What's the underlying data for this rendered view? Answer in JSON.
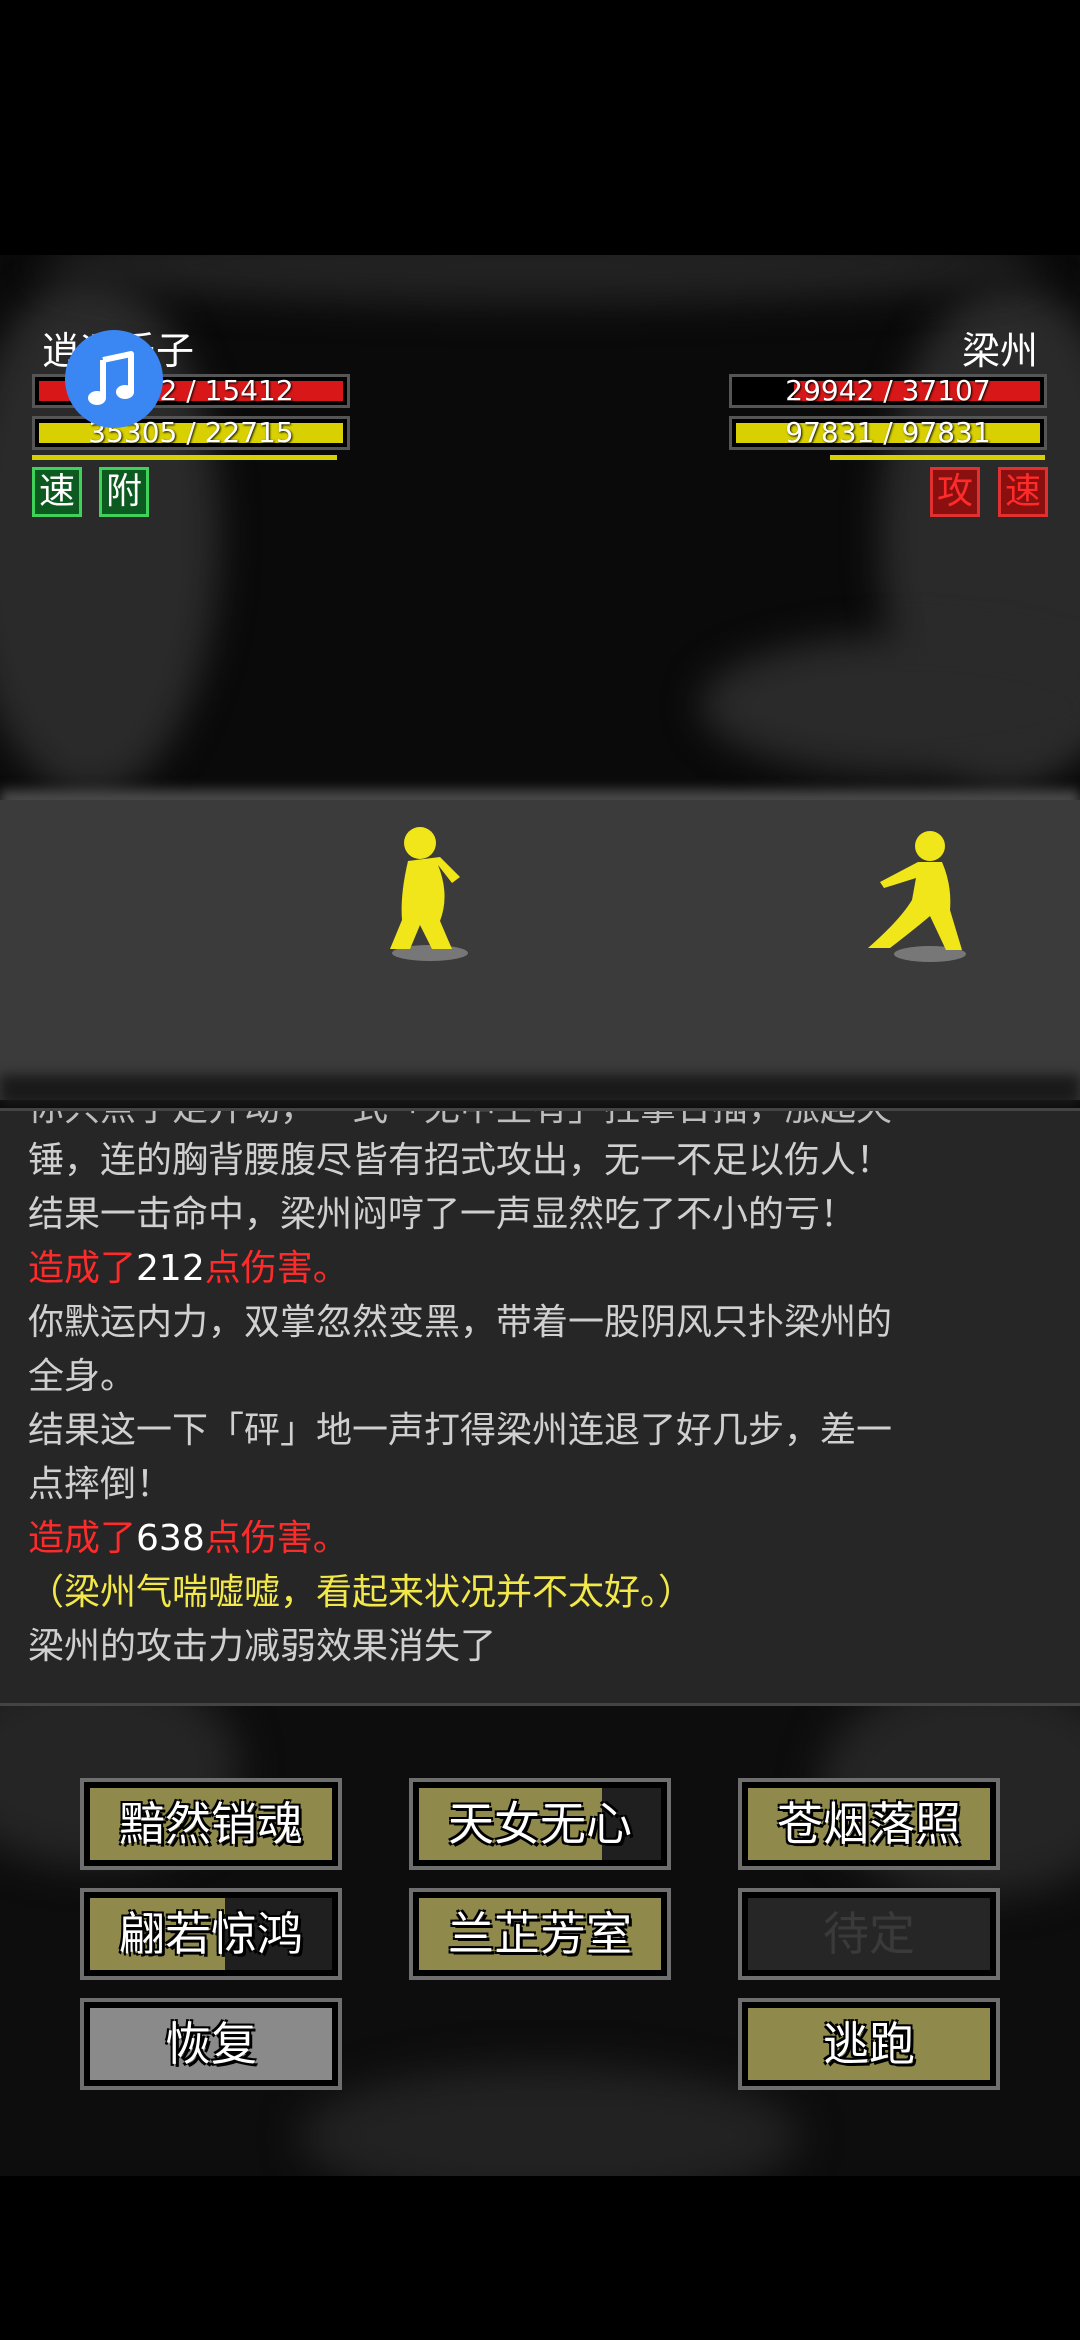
{
  "player": {
    "name": "逍遥乐子",
    "hp_text": "15412 / 15412",
    "hp_fraction": 1.0,
    "mp_text": "35305 / 22715",
    "mp_fraction": 1.0,
    "buffs": [
      "速",
      "附"
    ]
  },
  "enemy": {
    "name": "梁州",
    "hp_text": "29942 / 37107",
    "hp_fraction": 0.81,
    "mp_text": "97831 / 97831",
    "mp_fraction": 1.0,
    "buffs": [
      "攻",
      "速"
    ]
  },
  "music_icon": "music-note-icon",
  "log": {
    "partial_line": "你只点了足并动，一式「无中生有」拄掌合插，涨起天",
    "lines": [
      [
        {
          "text": "锤，连的胸背腰腹尽皆有招式攻出，无一不足以伤人！",
          "color": "gray"
        }
      ],
      [
        {
          "text": "结果一击命中，梁州闷哼了一声显然吃了不小的亏！",
          "color": "gray"
        }
      ],
      [
        {
          "text": "造成了",
          "color": "red"
        },
        {
          "text": "212",
          "color": "white"
        },
        {
          "text": "点伤害。",
          "color": "red"
        }
      ],
      [
        {
          "text": "你默运内力，双掌忽然变黑，带着一股阴风只扑梁州的",
          "color": "gray"
        }
      ],
      [
        {
          "text": "全身。",
          "color": "gray"
        }
      ],
      [
        {
          "text": "结果这一下「砰」地一声打得梁州连退了好几步，差一",
          "color": "gray"
        }
      ],
      [
        {
          "text": "点摔倒！",
          "color": "gray"
        }
      ],
      [
        {
          "text": "造成了",
          "color": "red"
        },
        {
          "text": "638",
          "color": "white"
        },
        {
          "text": "点伤害。",
          "color": "red"
        }
      ],
      [
        {
          "text": "（梁州气喘嘘嘘，看起来状况并不太好。）",
          "color": "yellow"
        }
      ],
      [
        {
          "text": "梁州的攻击力减弱效果消失了",
          "color": "gray"
        }
      ]
    ]
  },
  "skills": {
    "s1": {
      "label": "黯然销魂",
      "cooldown_fraction": 0.0
    },
    "s2": {
      "label": "天女无心",
      "cooldown_fraction": 0.25
    },
    "s3": {
      "label": "苍烟落照",
      "cooldown_fraction": 0.0
    },
    "s4": {
      "label": "翩若惊鸿",
      "cooldown_fraction": 0.45
    },
    "s5": {
      "label": "兰芷芳室",
      "cooldown_fraction": 0.0
    },
    "s6": {
      "label": "待定",
      "cooldown_fraction": 0.0
    },
    "recover": {
      "label": "恢复"
    },
    "flee": {
      "label": "逃跑"
    }
  },
  "colors": {
    "hp": "#d81818",
    "mp": "#d8d000",
    "skill": "#8f8a4c",
    "log_red": "#ff2b2b",
    "log_yellow": "#f2e84a"
  }
}
